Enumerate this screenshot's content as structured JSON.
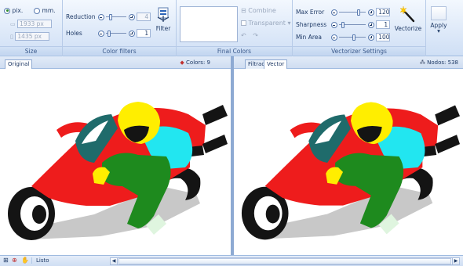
{
  "ribbon": {
    "size": {
      "title": "Size",
      "unit_px": "pix.",
      "unit_mm": "mm.",
      "width": "1933 px",
      "height": "1435 px"
    },
    "color_filters": {
      "title": "Color filters",
      "reduction_label": "Reduction",
      "reduction_value": "4",
      "reduction_level": 0.2,
      "holes_label": "Holes",
      "holes_value": "1",
      "holes_level": 0.1,
      "filter_label": "Filter"
    },
    "final_colors": {
      "title": "Final Colors",
      "combine_label": "Combine",
      "transparent_label": "Transparent"
    },
    "vectorizer": {
      "title": "Vectorizer Settings",
      "max_error_label": "Max Error",
      "max_error_value": "120",
      "max_error_level": 0.75,
      "sharpness_label": "Sharpness",
      "sharpness_value": "1",
      "sharpness_level": 0.1,
      "min_area_label": "Min Area",
      "min_area_value": "100",
      "min_area_level": 0.55,
      "vectorize_label": "Vectorize",
      "apply_label": "Apply"
    }
  },
  "left_pane": {
    "tab": "Original",
    "colors_text": "Colors: 9"
  },
  "right_pane": {
    "tabs": [
      "Filtrad",
      "Vector"
    ],
    "nodes_text": "Nodos: 538"
  },
  "status": {
    "text": "Listo"
  },
  "colors": {
    "red": "#ee1c1c",
    "yellow": "#ffee00",
    "cyan": "#22e6f0",
    "green": "#1e8a1e",
    "teal": "#1f6b6b",
    "black": "#141414",
    "gray": "#c8c8c8",
    "white": "#ffffff",
    "light_green": "#dff5df"
  }
}
